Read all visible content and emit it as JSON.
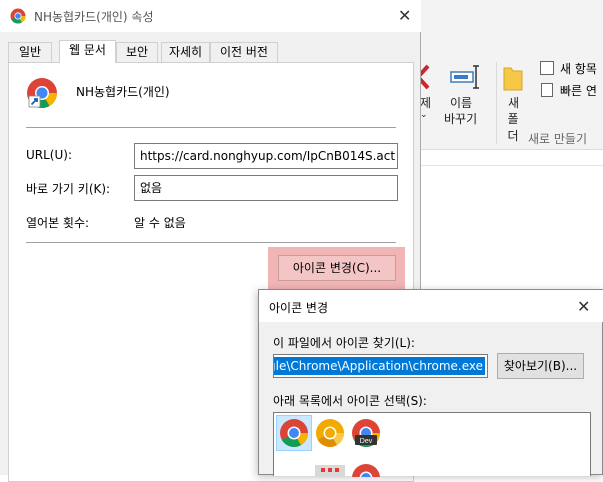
{
  "explorer": {
    "ribbon": {
      "delete_label": "제",
      "rename_label_1": "이름",
      "rename_label_2": "바꾸기",
      "new_folder_label_1": "새",
      "new_folder_label_2": "폴더",
      "new_item_label": "새 항목",
      "easy_access_label": "빠른 연",
      "group_new_label": "새로 만들기"
    }
  },
  "properties": {
    "title": "NH농협카드(개인) 속성",
    "tabs": [
      {
        "label": "일반"
      },
      {
        "label": "웹 문서"
      },
      {
        "label": "보안"
      },
      {
        "label": "자세히"
      },
      {
        "label": "이전 버전"
      }
    ],
    "name": "NH농협카드(개인)",
    "url_label": "URL(U):",
    "url_value": "https://card.nonghyup.com/IpCnB014S.act",
    "shortcut_label": "바로 가기 키(K):",
    "shortcut_value": "없음",
    "visits_label": "열어본 횟수:",
    "visits_value": "알 수 없음",
    "change_icon_button": "아이콘 변경(C)..."
  },
  "change_icon_dialog": {
    "title": "아이콘 변경",
    "find_label": "이 파일에서 아이콘 찾기(L):",
    "path_value": "gle\\Chrome\\Application\\chrome.exe",
    "browse_button": "찾아보기(B)...",
    "select_label": "아래 목록에서 아이콘 선택(S):",
    "icons": [
      {
        "name": "chrome-icon",
        "selected": true
      },
      {
        "name": "chrome-canary-icon",
        "selected": false
      },
      {
        "name": "chrome-dev-icon",
        "selected": false,
        "badge": "Dev"
      },
      {
        "name": "apps-grid-icon",
        "selected": false
      },
      {
        "name": "chrome-icon",
        "selected": false
      }
    ],
    "colors": {
      "selection": "#0078d7",
      "highlight": "#f2b5b5"
    }
  }
}
